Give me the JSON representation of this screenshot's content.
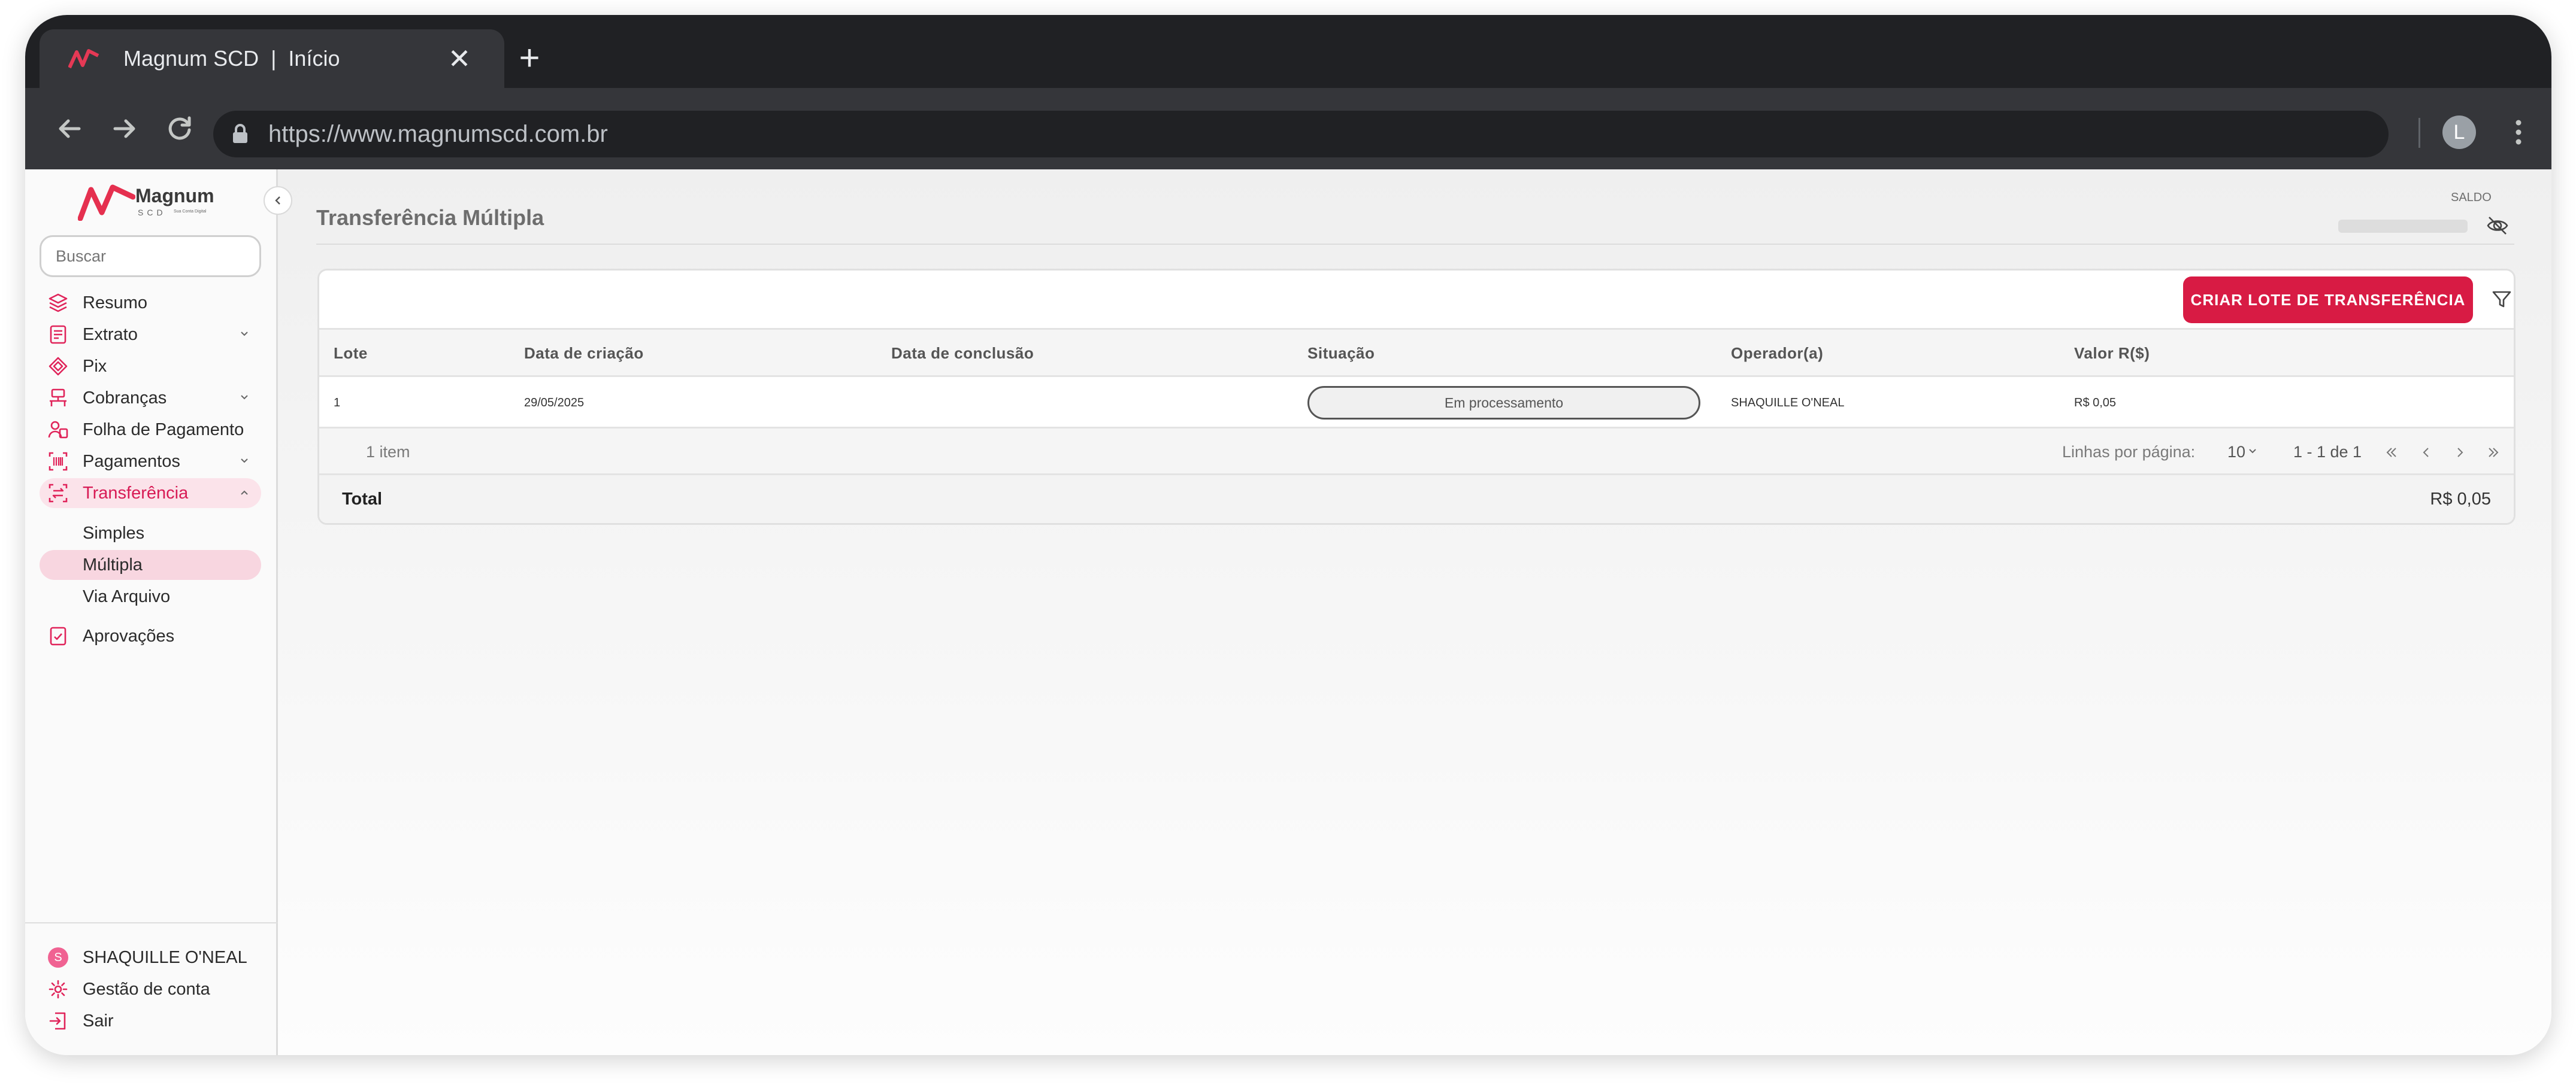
{
  "browser": {
    "tab_title": "Magnum SCD  |  Início",
    "close_glyph": "✕",
    "new_tab_glyph": "+",
    "url": "https://www.magnumscd.com.br",
    "profile_initial": "L"
  },
  "brand": {
    "name": "Magnum",
    "sub": "SCD",
    "tagline": "Sua Conta Digital",
    "accent": "#d81b44"
  },
  "sidebar": {
    "search_placeholder": "Buscar",
    "items": [
      {
        "label": "Resumo",
        "icon": "layers-icon"
      },
      {
        "label": "Extrato",
        "icon": "statement-icon"
      },
      {
        "label": "Pix",
        "icon": "pix-icon"
      },
      {
        "label": "Cobranças",
        "icon": "billing-icon"
      },
      {
        "label": "Folha de Pagamento",
        "icon": "payroll-icon"
      },
      {
        "label": "Pagamentos",
        "icon": "barcode-icon"
      },
      {
        "label": "Transferência",
        "icon": "transfer-icon"
      },
      {
        "label": "Aprovações",
        "icon": "approval-icon"
      }
    ],
    "sub_items": [
      "Simples",
      "Múltipla",
      "Via Arquivo"
    ],
    "footer": {
      "user_initial": "S",
      "user_name": "SHAQUILLE O'NEAL",
      "account": "Gestão de conta",
      "logout": "Sair"
    }
  },
  "header": {
    "title": "Transferência Múltipla",
    "balance_label": "SALDO"
  },
  "table": {
    "create_button": "CRIAR LOTE DE TRANSFERÊNCIA",
    "columns": [
      "Lote",
      "Data de criação",
      "Data de conclusão",
      "Situação",
      "Operador(a)",
      "Valor R($)"
    ],
    "rows": [
      {
        "lote": "1",
        "criacao": "29/05/2025",
        "conclusao": "",
        "situacao": "Em processamento",
        "operador": "SHAQUILLE O'NEAL",
        "valor": "R$ 0,05"
      }
    ],
    "pagination": {
      "count": "1 item",
      "rows_per_page_label": "Linhas por página:",
      "rows_per_page": "10",
      "range": "1 - 1 de 1"
    },
    "total_label": "Total",
    "total_value": "R$ 0,05"
  }
}
